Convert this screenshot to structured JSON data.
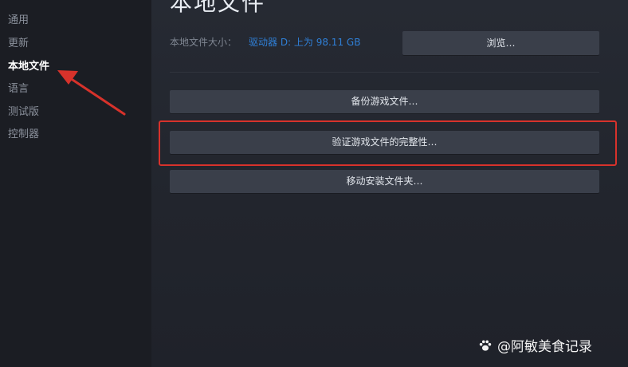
{
  "sidebar": {
    "items": [
      {
        "label": "通用"
      },
      {
        "label": "更新"
      },
      {
        "label": "本地文件"
      },
      {
        "label": "语言"
      },
      {
        "label": "测试版"
      },
      {
        "label": "控制器"
      }
    ]
  },
  "main": {
    "title": "本地文件",
    "size_label": "本地文件大小：",
    "size_value": "驱动器 D: 上为 98.11 GB",
    "browse_label": "浏览…",
    "backup_label": "备份游戏文件…",
    "verify_label": "验证游戏文件的完整性…",
    "move_label": "移动安装文件夹…"
  },
  "watermark": {
    "text": "@阿敏美食记录"
  },
  "colors": {
    "annotation_red": "#d7322b",
    "link_blue": "#2f7fd6",
    "button_bg": "#3a3f4a"
  }
}
